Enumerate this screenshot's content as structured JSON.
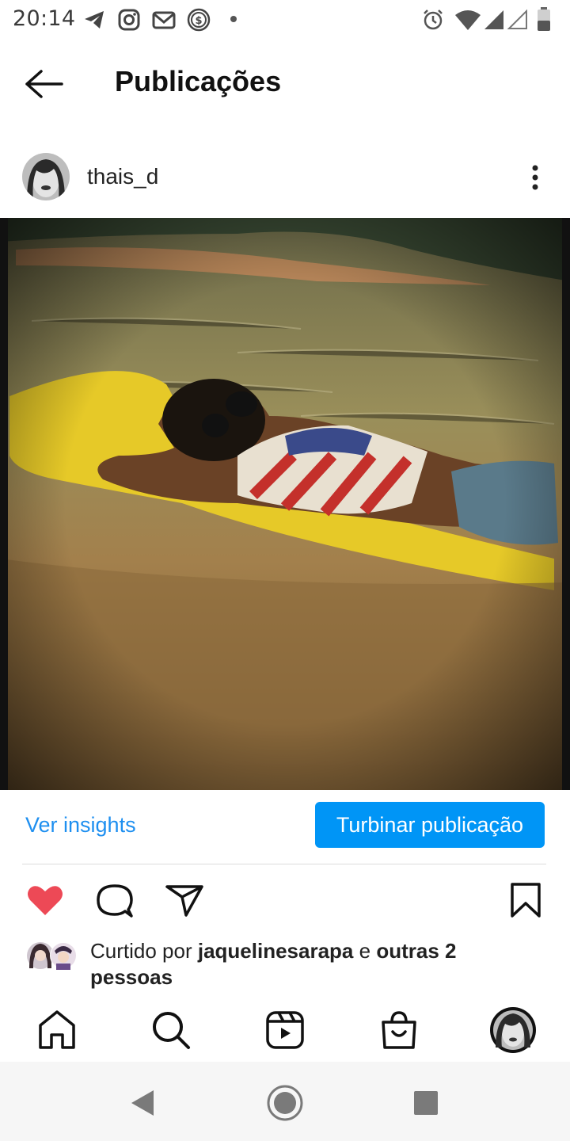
{
  "status_bar": {
    "time": "20:14",
    "left_icons": [
      "telegram-icon",
      "instagram-icon",
      "gmail-icon",
      "dollar-icon",
      "dot-icon"
    ],
    "right_icons": [
      "alarm-icon",
      "wifi-icon",
      "signal-icon",
      "signal-empty-icon",
      "battery-icon"
    ]
  },
  "header": {
    "title": "Publicações",
    "back_icon": "arrow-left-icon"
  },
  "post": {
    "username": "thais_d",
    "photo_description_icon": "photo",
    "insights_link": "Ver insights",
    "boost_button": "Turbinar publicação",
    "likes": {
      "prefix": "Curtido por",
      "first_liker": "jaquelinesarapa",
      "connector": "e",
      "others": "outras 2 pessoas"
    },
    "actions": [
      "heart-icon",
      "comment-icon",
      "share-icon",
      "bookmark-icon"
    ]
  },
  "bottom_nav": {
    "items": [
      "home-icon",
      "search-icon",
      "reels-icon",
      "shop-icon",
      "profile-avatar"
    ]
  },
  "system_nav": [
    "back-triangle-icon",
    "home-circle-icon",
    "recents-square-icon"
  ],
  "colors": {
    "accent": "#0095f6",
    "link": "#1e8ff0",
    "heart": "#ed4956"
  }
}
